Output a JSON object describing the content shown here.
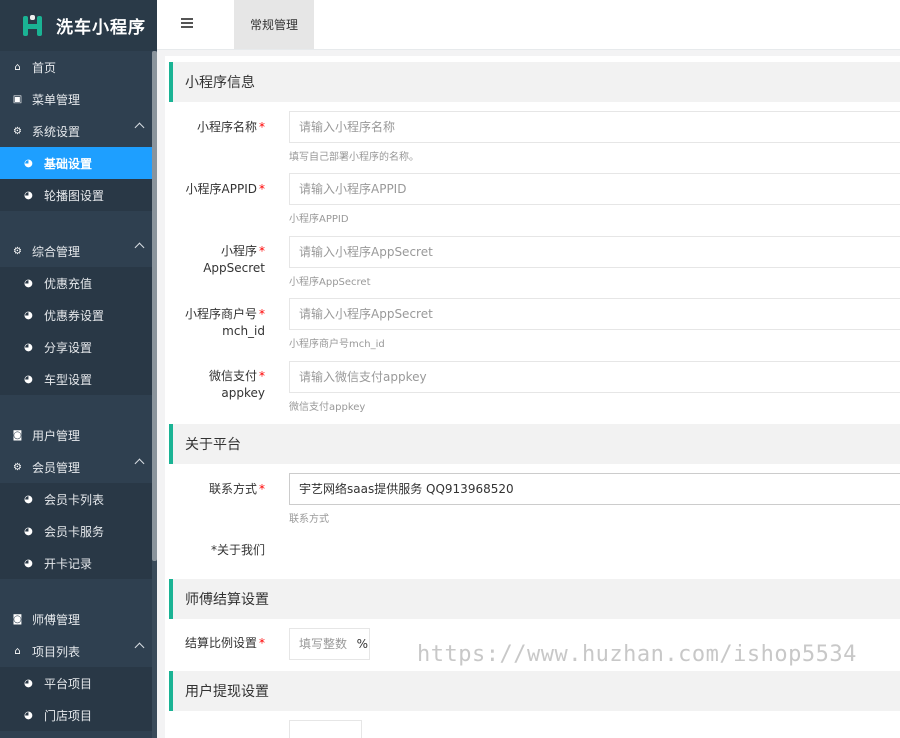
{
  "app": {
    "title": "洗车小程序"
  },
  "colors": {
    "accent": "#1ab394",
    "active": "#1e9fff",
    "sidebar": "#2f4050",
    "required": "#ff0000"
  },
  "sidebar": {
    "home": "首页",
    "menu_manage": "菜单管理",
    "system_settings": "系统设置",
    "basic_settings": "基础设置",
    "carousel_settings": "轮播图设置",
    "general_manage": "综合管理",
    "discount_recharge": "优惠充值",
    "coupon_settings": "优惠券设置",
    "share_settings": "分享设置",
    "car_model_settings": "车型设置",
    "user_manage": "用户管理",
    "member_manage": "会员管理",
    "member_card_list": "会员卡列表",
    "member_card_service": "会员卡服务",
    "card_open_records": "开卡记录",
    "master_manage": "师傅管理",
    "project_list": "项目列表",
    "platform_projects": "平台项目",
    "store_projects": "门店项目"
  },
  "header": {
    "tab_label": "常规管理"
  },
  "sections": {
    "mini_info": "小程序信息",
    "about_platform": "关于平台",
    "master_settlement": "师傅结算设置",
    "user_withdraw": "用户提现设置"
  },
  "form": {
    "name": {
      "label": "小程序名称",
      "placeholder": "请输入小程序名称",
      "hint": "填写自己部署小程序的名称。"
    },
    "appid": {
      "label": "小程序APPID",
      "placeholder": "请输入小程序APPID",
      "hint": "小程序APPID"
    },
    "appsecret": {
      "label_line1": "小程序",
      "label_line2": "AppSecret",
      "placeholder": "请输入小程序AppSecret",
      "hint": "小程序AppSecret"
    },
    "mch_id": {
      "label_line1": "小程序商户号",
      "label_line2": "mch_id",
      "placeholder": "请输入小程序AppSecret",
      "hint": "小程序商户号mch_id"
    },
    "appkey": {
      "label_line1": "微信支付",
      "label_line2": "appkey",
      "placeholder": "请输入微信支付appkey",
      "hint": "微信支付appkey"
    },
    "contact": {
      "label": "联系方式",
      "value": "宇艺网络saas提供服务 QQ913968520",
      "hint": "联系方式"
    },
    "about_us": {
      "label": "*关于我们"
    },
    "settlement": {
      "label": "结算比例设置",
      "placeholder": "填写整数",
      "unit": "%"
    }
  },
  "watermark": "https://www.huzhan.com/ishop5534"
}
